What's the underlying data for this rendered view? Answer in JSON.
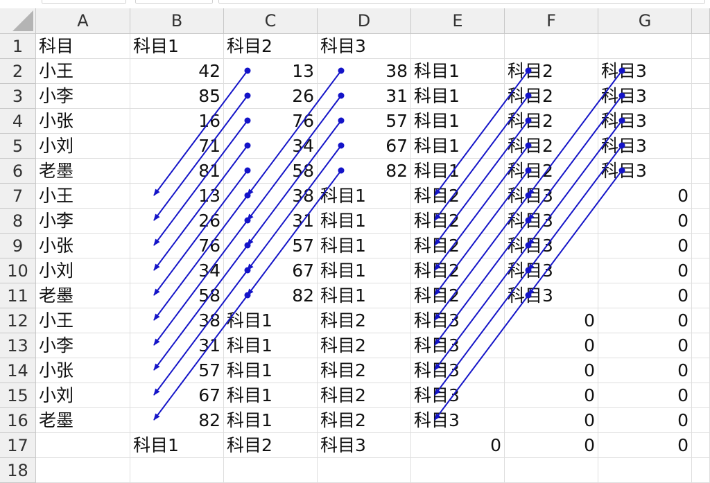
{
  "columns": [
    "A",
    "B",
    "C",
    "D",
    "E",
    "F",
    "G"
  ],
  "rows": [
    "1",
    "2",
    "3",
    "4",
    "5",
    "6",
    "7",
    "8",
    "9",
    "10",
    "11",
    "12",
    "13",
    "14",
    "15",
    "16",
    "17",
    "18"
  ],
  "cells": [
    [
      "科目",
      "科目1",
      "科目2",
      "科目3",
      "",
      "",
      ""
    ],
    [
      "小王",
      "42",
      "13",
      "38",
      "科目1",
      "科目2",
      "科目3"
    ],
    [
      "小李",
      "85",
      "26",
      "31",
      "科目1",
      "科目2",
      "科目3"
    ],
    [
      "小张",
      "16",
      "76",
      "57",
      "科目1",
      "科目2",
      "科目3"
    ],
    [
      "小刘",
      "71",
      "34",
      "67",
      "科目1",
      "科目2",
      "科目3"
    ],
    [
      "老墨",
      "81",
      "58",
      "82",
      "科目1",
      "科目2",
      "科目3"
    ],
    [
      "小王",
      "13",
      "38",
      "科目1",
      "科目2",
      "科目3",
      "0"
    ],
    [
      "小李",
      "26",
      "31",
      "科目1",
      "科目2",
      "科目3",
      "0"
    ],
    [
      "小张",
      "76",
      "57",
      "科目1",
      "科目2",
      "科目3",
      "0"
    ],
    [
      "小刘",
      "34",
      "67",
      "科目1",
      "科目2",
      "科目3",
      "0"
    ],
    [
      "老墨",
      "58",
      "82",
      "科目1",
      "科目2",
      "科目3",
      "0"
    ],
    [
      "小王",
      "38",
      "科目1",
      "科目2",
      "科目3",
      "0",
      "0"
    ],
    [
      "小李",
      "31",
      "科目1",
      "科目2",
      "科目3",
      "0",
      "0"
    ],
    [
      "小张",
      "57",
      "科目1",
      "科目2",
      "科目3",
      "0",
      "0"
    ],
    [
      "小刘",
      "67",
      "科目1",
      "科目2",
      "科目3",
      "0",
      "0"
    ],
    [
      "老墨",
      "82",
      "科目1",
      "科目2",
      "科目3",
      "0",
      "0"
    ],
    [
      "",
      "科目1",
      "科目2",
      "科目3",
      "0",
      "0",
      "0"
    ],
    [
      "",
      "",
      "",
      "",
      "",
      "",
      ""
    ]
  ],
  "arrow_color": "#1414c8"
}
